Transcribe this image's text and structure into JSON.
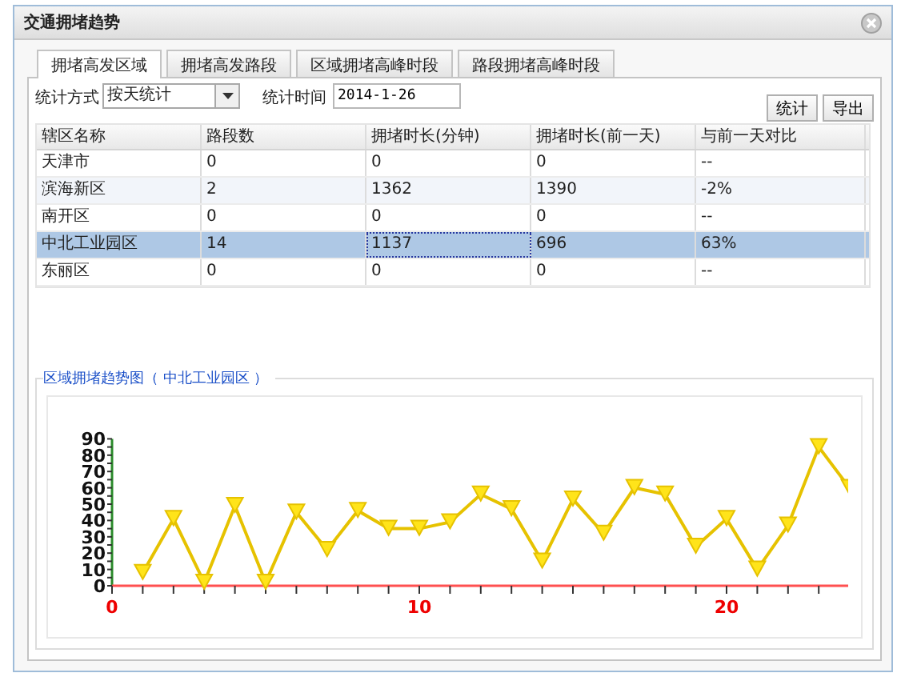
{
  "window": {
    "title": "交通拥堵趋势"
  },
  "tabs": [
    {
      "label": "拥堵高发区域",
      "selected": true
    },
    {
      "label": "拥堵高发路段",
      "selected": false
    },
    {
      "label": "区域拥堵高峰时段",
      "selected": false
    },
    {
      "label": "路段拥堵高峰时段",
      "selected": false
    }
  ],
  "filters": {
    "method_label": "统计方式",
    "method_value": "按天统计",
    "date_label": "统计时间",
    "date_value": "2014-1-26"
  },
  "buttons": [
    "统计",
    "导出"
  ],
  "table": {
    "columns": [
      "辖区名称",
      "路段数",
      "拥堵时长(分钟)",
      "拥堵时长(前一天)",
      "与前一天对比"
    ],
    "rows": [
      {
        "selected": false,
        "cells": [
          {
            "text": "天津市",
            "focused": false
          },
          {
            "text": "0",
            "focused": false
          },
          {
            "text": "0",
            "focused": false
          },
          {
            "text": "0",
            "focused": false
          },
          {
            "text": "--",
            "focused": false
          }
        ]
      },
      {
        "selected": false,
        "cells": [
          {
            "text": "滨海新区",
            "focused": false
          },
          {
            "text": "2",
            "focused": false
          },
          {
            "text": "1362",
            "focused": false
          },
          {
            "text": "1390",
            "focused": false
          },
          {
            "text": "-2%",
            "focused": false
          }
        ]
      },
      {
        "selected": false,
        "cells": [
          {
            "text": "南开区",
            "focused": false
          },
          {
            "text": "0",
            "focused": false
          },
          {
            "text": "0",
            "focused": false
          },
          {
            "text": "0",
            "focused": false
          },
          {
            "text": "--",
            "focused": false
          }
        ]
      },
      {
        "selected": true,
        "cells": [
          {
            "text": "中北工业园区",
            "focused": false
          },
          {
            "text": "14",
            "focused": false
          },
          {
            "text": "1137",
            "focused": true
          },
          {
            "text": "696",
            "focused": false
          },
          {
            "text": "63%",
            "focused": false
          }
        ]
      },
      {
        "selected": false,
        "cells": [
          {
            "text": "东丽区",
            "focused": false
          },
          {
            "text": "0",
            "focused": false
          },
          {
            "text": "0",
            "focused": false
          },
          {
            "text": "0",
            "focused": false
          },
          {
            "text": "--",
            "focused": false
          }
        ]
      }
    ]
  },
  "trend": {
    "title": "区域拥堵趋势图（ 中北工业园区 ）",
    "chart_data": {
      "type": "line",
      "x": [
        1,
        2,
        3,
        4,
        5,
        6,
        7,
        8,
        9,
        10,
        11,
        12,
        13,
        14,
        15,
        16,
        17,
        18,
        19,
        20,
        21,
        22,
        23,
        24
      ],
      "series": [
        {
          "marker": "triangle-down",
          "color": "#e6c200",
          "values": [
            8,
            41,
            2,
            49,
            2,
            45,
            22,
            46,
            35,
            35,
            39,
            56,
            47,
            15,
            53,
            32,
            60,
            56,
            24,
            41,
            10,
            37,
            85,
            60
          ]
        }
      ],
      "xlim": [
        0,
        24
      ],
      "ylim": [
        0,
        90
      ],
      "xticks": [
        0,
        10,
        20
      ],
      "yticks": [
        0,
        10,
        20,
        30,
        40,
        50,
        60,
        70,
        80,
        90
      ]
    }
  }
}
